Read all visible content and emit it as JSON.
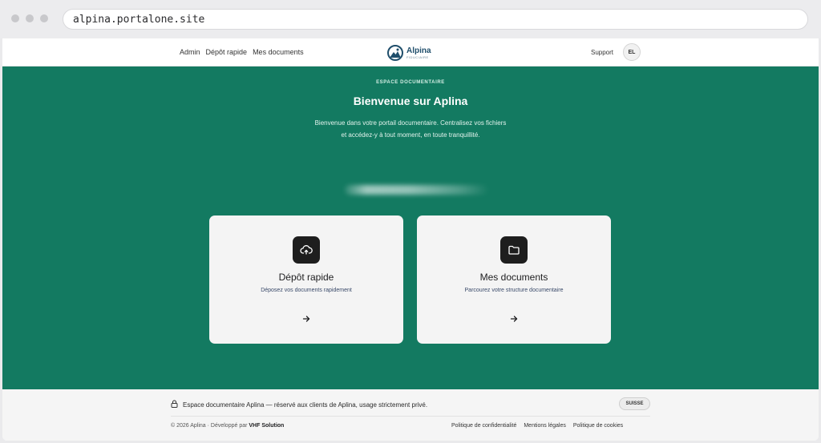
{
  "browser": {
    "url": "alpina.portalone.site"
  },
  "header": {
    "nav": [
      "Admin",
      "Dépôt rapide",
      "Mes documents"
    ],
    "logo_name": "Alpina",
    "logo_sub": "FIDUCIAIRE",
    "support": "Support",
    "avatar": "EL"
  },
  "hero": {
    "eyebrow": "ESPACE DOCUMENTAIRE",
    "title": "Bienvenue sur Aplina",
    "description": "Bienvenue dans votre portail documentaire. Centralisez vos fichiers et accédez-y à tout moment, en toute tranquillité.",
    "cards": [
      {
        "title": "Dépôt rapide",
        "subtitle": "Déposez vos documents rapidement",
        "icon": "cloud-upload-icon"
      },
      {
        "title": "Mes documents",
        "subtitle": "Parcourez votre structure documentaire",
        "icon": "folder-icon"
      }
    ]
  },
  "footer": {
    "notice": "Espace documentaire Aplina — réservé aux clients de Aplina, usage strictement privé.",
    "country": "SUISSE",
    "copyright_prefix": "© 2026 Aplina · Développé par ",
    "developer": "VHF Solution",
    "links": [
      "Politique de confidentialité",
      "Mentions légales",
      "Politique de cookies"
    ]
  },
  "colors": {
    "accent": "#137a61",
    "card": "#f4f4f4",
    "icon_tile": "#1e1e1e",
    "logo": "#1f4e6b"
  }
}
